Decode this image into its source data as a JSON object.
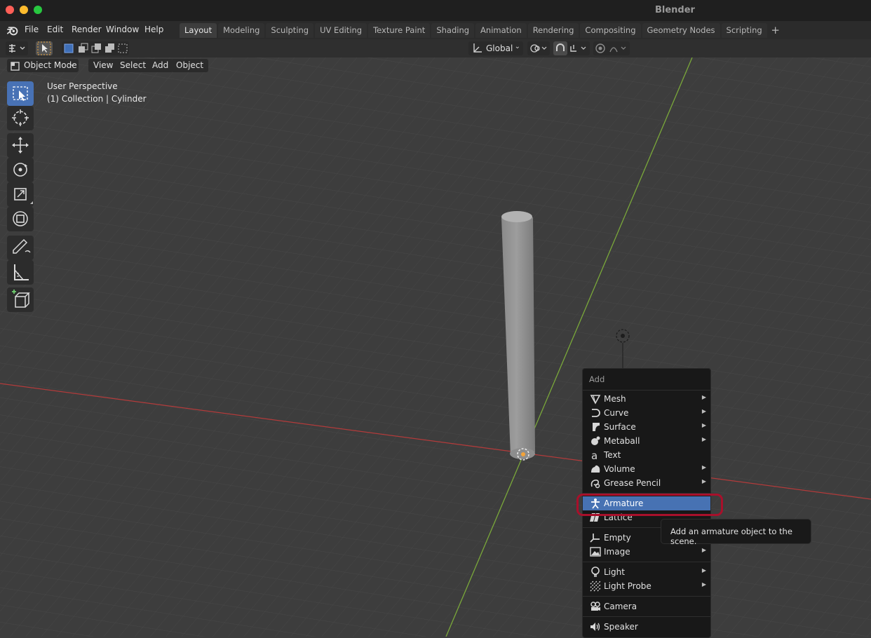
{
  "window": {
    "title": "Blender"
  },
  "menubar": {
    "items": [
      "File",
      "Edit",
      "Render",
      "Window",
      "Help"
    ]
  },
  "workspaces": {
    "tabs": [
      "Layout",
      "Modeling",
      "Sculpting",
      "UV Editing",
      "Texture Paint",
      "Shading",
      "Animation",
      "Rendering",
      "Compositing",
      "Geometry Nodes",
      "Scripting"
    ],
    "active": "Layout",
    "add_label": "+"
  },
  "header": {
    "mode": "Object Mode",
    "view_menus": [
      "View",
      "Select",
      "Add",
      "Object"
    ],
    "transform_orientation": "Global"
  },
  "viewport": {
    "perspective": "User Perspective",
    "collection": "(1) Collection | Cylinder"
  },
  "toolbar": {
    "tools": [
      "select-box-icon",
      "cursor-icon",
      "move-icon",
      "rotate-icon",
      "scale-icon",
      "transform-icon",
      "annotate-icon",
      "measure-icon",
      "add-cube-icon"
    ],
    "active": "select-box-icon"
  },
  "add_menu": {
    "title": "Add",
    "items": [
      {
        "label": "Mesh",
        "icon": "mesh-icon",
        "submenu": true
      },
      {
        "label": "Curve",
        "icon": "curve-icon",
        "submenu": true
      },
      {
        "label": "Surface",
        "icon": "surface-icon",
        "submenu": true
      },
      {
        "label": "Metaball",
        "icon": "metaball-icon",
        "submenu": true
      },
      {
        "label": "Text",
        "icon": "text-icon",
        "submenu": false
      },
      {
        "label": "Volume",
        "icon": "volume-icon",
        "submenu": true
      },
      {
        "label": "Grease Pencil",
        "icon": "grease-pencil-icon",
        "submenu": true
      },
      {
        "label": "Armature",
        "icon": "armature-icon",
        "submenu": false,
        "highlighted": true
      },
      {
        "label": "Lattice",
        "icon": "lattice-icon",
        "submenu": false
      },
      {
        "label": "Empty",
        "icon": "empty-icon",
        "submenu": true
      },
      {
        "label": "Image",
        "icon": "image-icon",
        "submenu": true
      },
      {
        "label": "Light",
        "icon": "light-icon",
        "submenu": true
      },
      {
        "label": "Light Probe",
        "icon": "light-probe-icon",
        "submenu": true
      },
      {
        "label": "Camera",
        "icon": "camera-icon",
        "submenu": false
      },
      {
        "label": "Speaker",
        "icon": "speaker-icon",
        "submenu": false
      }
    ],
    "arrow": "▶"
  },
  "tooltip": {
    "text": "Add an armature object to the scene."
  },
  "colors": {
    "accent": "#4772b3",
    "highlight_ring": "#a8102b",
    "x_axis": "#b33b3b",
    "y_axis": "#7aa83a"
  }
}
